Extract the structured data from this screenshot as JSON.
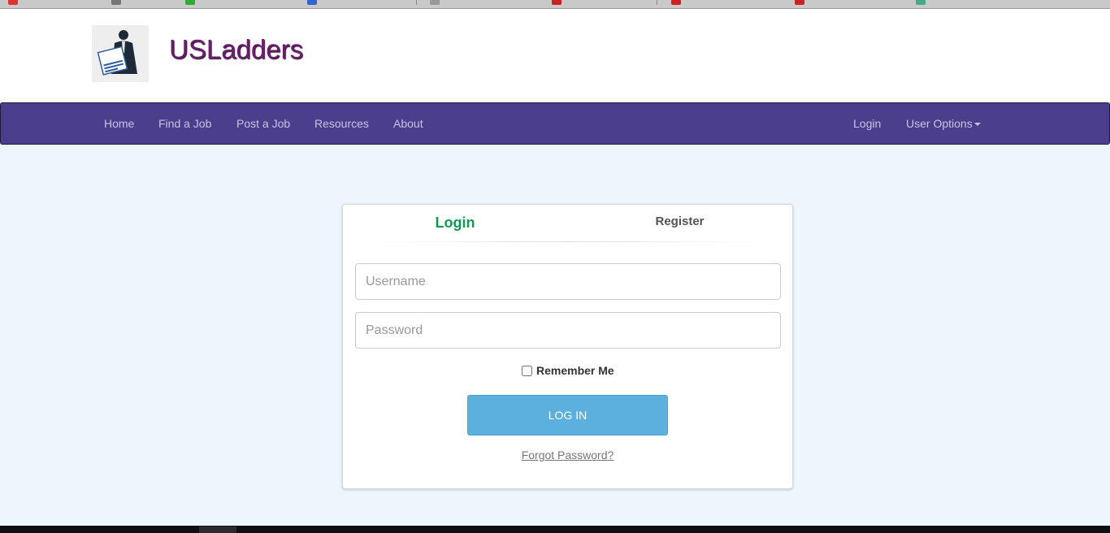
{
  "site": {
    "brand": "USLadders",
    "logo_icon": "jobs-newspaper-man-icon"
  },
  "nav": {
    "left": [
      "Home",
      "Find a Job",
      "Post a Job",
      "Resources",
      "About"
    ],
    "login": "Login",
    "user_options": "User Options"
  },
  "panel": {
    "tab_login": "Login",
    "tab_register": "Register",
    "username_placeholder": "Username",
    "password_placeholder": "Password",
    "remember_me": "Remember Me",
    "login_button": "LOG IN",
    "forgot_password": "Forgot Password?"
  },
  "colors": {
    "navbar": "#4b3e8d",
    "brand": "#6b1e6e",
    "active_tab": "#0e9a50",
    "button": "#5bb0dd",
    "page_bg": "#eef6fd"
  }
}
